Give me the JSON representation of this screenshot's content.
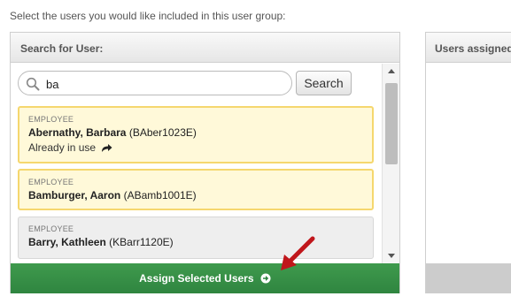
{
  "instruction": "Select the users you would like included in this user group:",
  "left_panel": {
    "title": "Search for User:",
    "search": {
      "value": "ba",
      "button_label": "Search"
    },
    "results": [
      {
        "type": "EMPLOYEE",
        "name": "Abernathy, Barbara",
        "id": "(BAber1023E)",
        "status": "Already in use",
        "selected": true
      },
      {
        "type": "EMPLOYEE",
        "name": "Bamburger, Aaron",
        "id": "(ABamb1001E)",
        "selected": true
      },
      {
        "type": "EMPLOYEE",
        "name": "Barry, Kathleen",
        "id": "(KBarr1120E)",
        "selected": false
      }
    ],
    "assign_button_label": "Assign Selected Users"
  },
  "right_panel": {
    "title": "Users assigned"
  },
  "colors": {
    "assign_button": "#2f8540",
    "selected_card_bg": "#fff9d9",
    "selected_card_border": "#f5d76e",
    "annotation_arrow": "#c0161b"
  },
  "icons": [
    "search-icon",
    "share-arrow-icon",
    "circle-arrow-right-icon",
    "scroll-up-icon",
    "scroll-down-icon"
  ]
}
